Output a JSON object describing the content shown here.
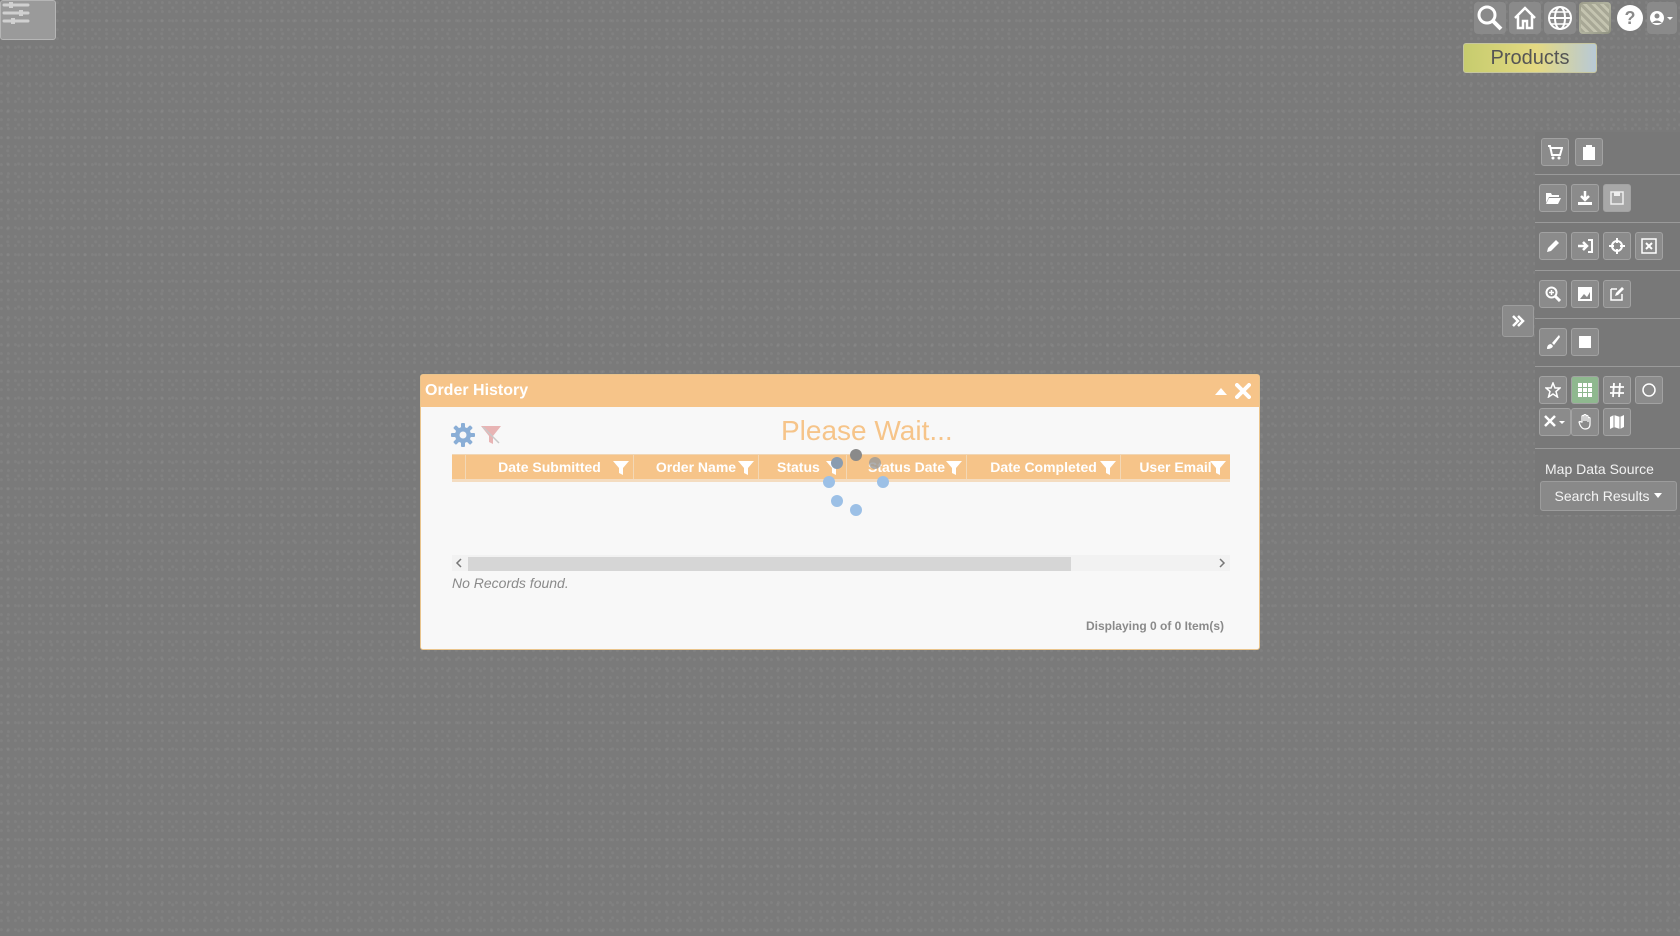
{
  "topbar": {
    "products_label": "Products",
    "icons": [
      "search-icon",
      "home-icon",
      "globe-icon",
      "basemap-thumbnail-icon",
      "help-icon",
      "user-icon"
    ]
  },
  "right_panel": {
    "map_data_source_label": "Map Data Source",
    "search_results_label": "Search Results"
  },
  "dialog": {
    "title": "Order History",
    "loading_text": "Please Wait...",
    "columns": [
      "Date Submitted",
      "Order Name",
      "Status",
      "Status Date",
      "Date Completed",
      "User Email"
    ],
    "empty_text": "No Records found.",
    "footer_text": "Displaying 0 of 0 Item(s)"
  },
  "colors": {
    "accent_orange": "#f6c489",
    "active_green": "#8fb88f",
    "spinner_blue": "#9cc0e6"
  }
}
